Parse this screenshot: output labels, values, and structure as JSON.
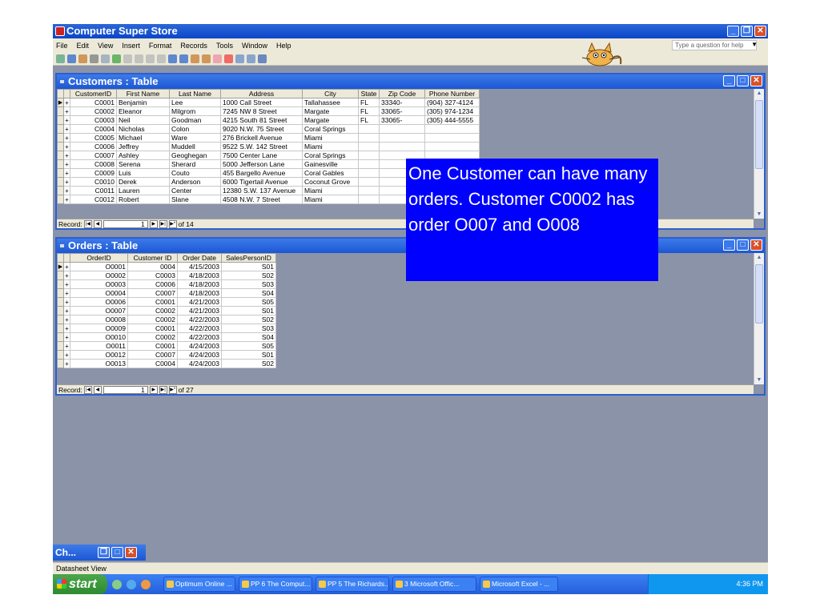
{
  "app": {
    "title": "Computer Super Store",
    "menu": [
      "File",
      "Edit",
      "View",
      "Insert",
      "Format",
      "Records",
      "Tools",
      "Window",
      "Help"
    ],
    "help_placeholder": "Type a question for help"
  },
  "customers": {
    "title": "Customers : Table",
    "columns": [
      "CustomerID",
      "First Name",
      "Last Name",
      "Address",
      "City",
      "State",
      "Zip Code",
      "Phone Number"
    ],
    "rows": [
      [
        "C0001",
        "Benjamin",
        "Lee",
        "1000 Call Street",
        "Tallahassee",
        "FL",
        "33340-",
        "(904) 327-4124"
      ],
      [
        "C0002",
        "Eleanor",
        "Milgrom",
        "7245 NW 8 Street",
        "Margate",
        "FL",
        "33065-",
        "(305) 974-1234"
      ],
      [
        "C0003",
        "Neil",
        "Goodman",
        "4215 South 81 Street",
        "Margate",
        "FL",
        "33065-",
        "(305) 444-5555"
      ],
      [
        "C0004",
        "Nicholas",
        "Colon",
        "9020 N.W. 75 Street",
        "Coral Springs",
        "",
        "",
        ""
      ],
      [
        "C0005",
        "Michael",
        "Ware",
        "276 Brickell Avenue",
        "Miami",
        "",
        "",
        ""
      ],
      [
        "C0006",
        "Jeffrey",
        "Muddell",
        "9522 S.W. 142 Street",
        "Miami",
        "",
        "",
        ""
      ],
      [
        "C0007",
        "Ashley",
        "Geoghegan",
        "7500 Center Lane",
        "Coral Springs",
        "",
        "",
        ""
      ],
      [
        "C0008",
        "Serena",
        "Sherard",
        "5000 Jefferson Lane",
        "Gainesville",
        "",
        "",
        ""
      ],
      [
        "C0009",
        "Luis",
        "Couto",
        "455 Bargello Avenue",
        "Coral Gables",
        "",
        "",
        ""
      ],
      [
        "C0010",
        "Derek",
        "Anderson",
        "6000 Tigertail Avenue",
        "Coconut Grove",
        "",
        "",
        ""
      ],
      [
        "C0011",
        "Lauren",
        "Center",
        "12380 S.W. 137 Avenue",
        "Miami",
        "",
        "",
        ""
      ],
      [
        "C0012",
        "Robert",
        "Slane",
        "4508 N.W. 7 Street",
        "Miami",
        "",
        "",
        ""
      ]
    ],
    "record_label": "Record:",
    "record_value": "1",
    "record_total": "of 14"
  },
  "orders": {
    "title": "Orders : Table",
    "columns": [
      "OrderID",
      "Customer ID",
      "Order Date",
      "SalesPersonID"
    ],
    "rows": [
      [
        "O0001",
        "0004",
        "4/15/2003",
        "S01"
      ],
      [
        "O0002",
        "C0003",
        "4/18/2003",
        "S02"
      ],
      [
        "O0003",
        "C0006",
        "4/18/2003",
        "S03"
      ],
      [
        "O0004",
        "C0007",
        "4/18/2003",
        "S04"
      ],
      [
        "O0006",
        "C0001",
        "4/21/2003",
        "S05"
      ],
      [
        "O0007",
        "C0002",
        "4/21/2003",
        "S01"
      ],
      [
        "O0008",
        "C0002",
        "4/22/2003",
        "S02"
      ],
      [
        "O0009",
        "C0001",
        "4/22/2003",
        "S03"
      ],
      [
        "O0010",
        "C0002",
        "4/22/2003",
        "S04"
      ],
      [
        "O0011",
        "C0001",
        "4/24/2003",
        "S05"
      ],
      [
        "O0012",
        "C0007",
        "4/24/2003",
        "S01"
      ],
      [
        "O0013",
        "C0004",
        "4/24/2003",
        "S02"
      ]
    ],
    "record_label": "Record:",
    "record_value": "1",
    "record_total": "of 27"
  },
  "callout": "One Customer can have many orders. Customer C0002 has order O007 and O008",
  "minimized": {
    "label": "Ch..."
  },
  "status": "Datasheet View",
  "taskbar": {
    "start": "start",
    "tasks": [
      "Optimum Online ...",
      "PP 6 The Comput...",
      "PP 5 The Richards...",
      "3 Microsoft Offic...",
      "Microsoft Excel - ..."
    ],
    "clock": "4:36 PM"
  }
}
